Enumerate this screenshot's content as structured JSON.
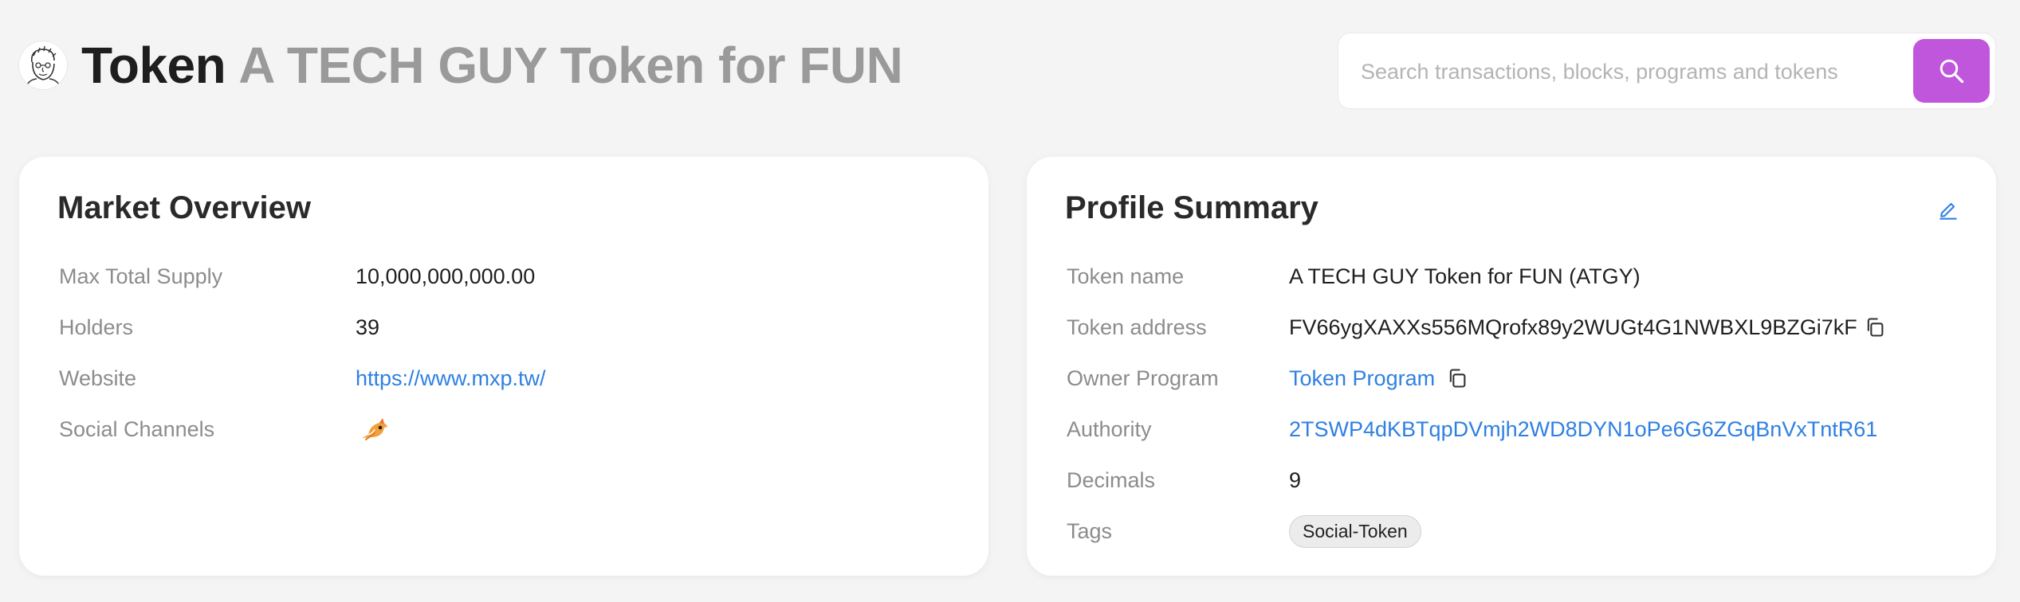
{
  "header": {
    "label": "Token",
    "token_name": "A TECH GUY Token for FUN",
    "logo_icon": "avatar-sketch-icon"
  },
  "search": {
    "placeholder": "Search transactions, blocks, programs and tokens",
    "value": "",
    "button_icon": "search-icon",
    "button_color": "#c056dc"
  },
  "market_overview": {
    "title": "Market Overview",
    "rows": [
      {
        "label": "Max Total Supply",
        "value": "10,000,000,000.00"
      },
      {
        "label": "Holders",
        "value": "39"
      },
      {
        "label": "Website",
        "value": "https://www.mxp.tw/"
      },
      {
        "label": "Social Channels",
        "icon": "bird-icon"
      }
    ]
  },
  "profile_summary": {
    "title": "Profile Summary",
    "edit_icon": "pencil-icon",
    "rows": [
      {
        "label": "Token name",
        "value": "A TECH GUY Token for FUN (ATGY)"
      },
      {
        "label": "Token address",
        "value": "FV66ygXAXXs556MQrofx89y2WUGt4G1NWBXL9BZGi7kF",
        "icon": "copy-icon"
      },
      {
        "label": "Owner Program",
        "value": "Token Program",
        "icon": "copy-icon"
      },
      {
        "label": "Authority",
        "value": "2TSWP4dKBTqpDVmjh2WD8DYN1oPe6G6ZGqBnVxTntR61"
      },
      {
        "label": "Decimals",
        "value": "9"
      },
      {
        "label": "Tags",
        "value": "Social-Token"
      }
    ]
  },
  "colors": {
    "accent": "#c056dc",
    "link": "#2f80e2",
    "background": "#f4f4f4"
  }
}
